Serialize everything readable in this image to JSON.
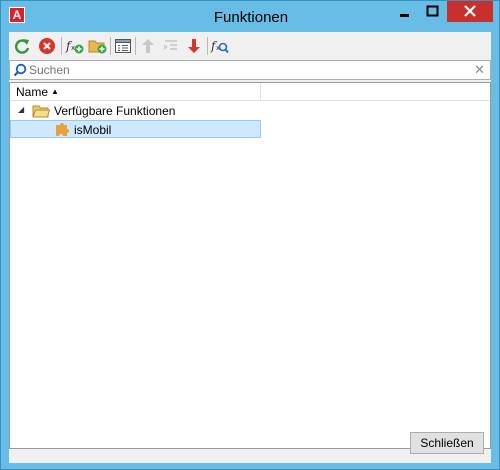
{
  "window": {
    "title": "Funktionen",
    "app_icon_letter": "A",
    "controls": {
      "minimize": "minimize-icon",
      "maximize": "maximize-icon",
      "close": "close-icon"
    }
  },
  "toolbar": {
    "buttons": [
      {
        "icon": "refresh-icon",
        "enabled": true
      },
      {
        "icon": "delete-icon",
        "enabled": true
      },
      {
        "icon": "new-function-icon",
        "enabled": true
      },
      {
        "icon": "new-folder-icon",
        "enabled": true
      },
      {
        "icon": "properties-icon",
        "enabled": true
      },
      {
        "icon": "move-up-icon",
        "enabled": false
      },
      {
        "icon": "indent-icon",
        "enabled": false
      },
      {
        "icon": "move-down-icon",
        "enabled": true
      },
      {
        "icon": "find-function-icon",
        "enabled": true
      }
    ]
  },
  "search": {
    "placeholder": "Suchen",
    "value": ""
  },
  "tree": {
    "column_header": "Name",
    "sort": "ascending",
    "root": {
      "label": "Verfügbare Funktionen",
      "expanded": true,
      "icon": "folder-icon",
      "children": [
        {
          "label": "isMobil",
          "icon": "plugin-icon",
          "selected": true
        }
      ]
    }
  },
  "footer": {
    "close_label": "Schließen"
  },
  "colors": {
    "window_frame": "#68bde6",
    "close_button": "#c7302c",
    "selection": "#cde8ff",
    "selection_border": "#99c9ef"
  }
}
